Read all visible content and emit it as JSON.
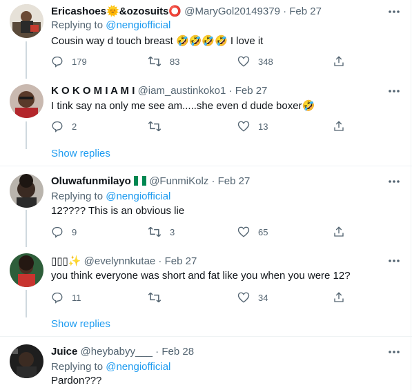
{
  "replying_prefix": "Replying to ",
  "tweets": [
    {
      "name": "Ericashoes",
      "name_emoji_1": "🌞",
      "name_mid": "&ozosuits",
      "name_emoji_2": "⭕",
      "handle": "@MaryGol20149379",
      "dot": "·",
      "date": "Feb 27",
      "replying_to": "@nengiofficial",
      "text": "Cousin way d touch breast ",
      "text_emoji": "🤣🤣🤣🤣",
      "text_after": " I love it",
      "replies": "179",
      "retweets": "83",
      "likes": "348"
    },
    {
      "name": "K O K O M I A M I",
      "handle": "@iam_austinkoko1",
      "dot": "·",
      "date": "Feb 27",
      "text": "I tink say na only me see am.....she even d dude boxer",
      "text_emoji": "🤣",
      "replies": "2",
      "retweets": "",
      "likes": "13",
      "show_replies": "Show replies"
    },
    {
      "name": "Oluwafunmilayo",
      "name_flag": "NG",
      "handle": "@FunmiKolz",
      "dot": "·",
      "date": "Feb 27",
      "replying_to": "@nengiofficial",
      "text": "12???? This is an obvious lie",
      "replies": "9",
      "retweets": "3",
      "likes": "65"
    },
    {
      "name": "▯▯▯",
      "name_emoji": "✨",
      "handle": "@evelynnkutae",
      "dot": "·",
      "date": "Feb 27",
      "text": "you think everyone was short and fat like you when you were 12?",
      "replies": "11",
      "retweets": "",
      "likes": "34",
      "show_replies": "Show replies"
    },
    {
      "name": "Juice",
      "handle": "@heybabyy___",
      "dot": "·",
      "date": "Feb 28",
      "replying_to": "@nengiofficial",
      "text": "Pardon???"
    }
  ],
  "colors": {
    "accent": "#1d9bf0",
    "secondary_text": "#536471",
    "primary_text": "#0f1419",
    "divider": "#eff3f4"
  },
  "icons": [
    "reply-icon",
    "retweet-icon",
    "like-icon",
    "share-icon",
    "more-icon"
  ]
}
